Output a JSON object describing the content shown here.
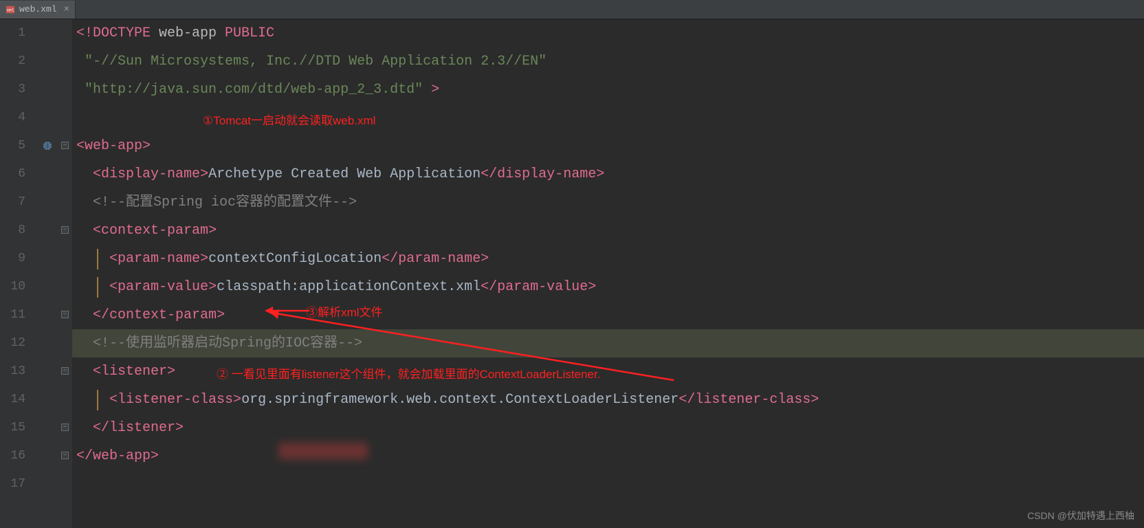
{
  "tab": {
    "filename": "web.xml"
  },
  "lines": {
    "l1_docopen": "<!DOCTYPE ",
    "l1_app": "web-app ",
    "l1_public": "PUBLIC",
    "l2": "\"-//Sun Microsystems, Inc.//DTD Web Application 2.3//EN\"",
    "l3a": "\"http://java.sun.com/dtd/web-app_2_3.dtd\" ",
    "l3b": ">",
    "l5_open": "<",
    "l5_tag": "web-app",
    "l5_close": ">",
    "l6_o": "<",
    "l6_tag": "display-name",
    "l6_c": ">",
    "l6_txt": "Archetype Created Web Application",
    "l6_eo": "</",
    "l6_ec": ">",
    "l7": "<!--配置Spring ioc容器的配置文件-->",
    "l8_o": "<",
    "l8_tag": "context-param",
    "l8_c": ">",
    "l9_o": "<",
    "l9_tag": "param-name",
    "l9_c": ">",
    "l9_txt": "contextConfigLocation",
    "l9_eo": "</",
    "l9_ec": ">",
    "l10_o": "<",
    "l10_tag": "param-value",
    "l10_c": ">",
    "l10_txt": "classpath:applicationContext.xml",
    "l10_eo": "</",
    "l10_ec": ">",
    "l11_o": "</",
    "l11_tag": "context-param",
    "l11_c": ">",
    "l12": "<!--使用监听器启动Spring的IOC容器-->",
    "l13_o": "<",
    "l13_tag": "listener",
    "l13_c": ">",
    "l14_o": "<",
    "l14_tag": "listener-class",
    "l14_c": ">",
    "l14_txt": "org.springframework.web.context.ContextLoaderListener",
    "l14_eo": "</",
    "l14_ec": ">",
    "l15_o": "</",
    "l15_tag": "listener",
    "l15_c": ">",
    "l16_o": "</",
    "l16_tag": "web-app",
    "l16_c": ">"
  },
  "annotations": {
    "a1": "①Tomcat一启动就会读取web.xml",
    "a2": "② 一看见里面有listener这个组件，就会加载里面的ContextLoaderListener.",
    "a3": "③解析xml文件"
  },
  "watermark": "CSDN @伏加特遇上西柚",
  "line_numbers": [
    "1",
    "2",
    "3",
    "4",
    "5",
    "6",
    "7",
    "8",
    "9",
    "10",
    "11",
    "12",
    "13",
    "14",
    "15",
    "16",
    "17"
  ]
}
